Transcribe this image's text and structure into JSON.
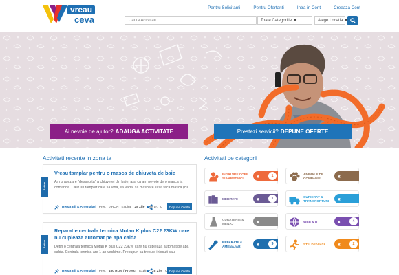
{
  "logo": {
    "brand_top": "vreau",
    "brand_bottom": "ceva"
  },
  "topnav": [
    "Pentru Solicitanti",
    "Pentru Ofertanti",
    "Intra in Cont",
    "Creeaza Cont"
  ],
  "search": {
    "placeholder": "Cauta Activitati...",
    "category_select": "Toate Categoriile",
    "location_select": "Alege Locatia"
  },
  "hero": {
    "help_text": "Ai nevoie de ajutor?",
    "help_action": "ADAUGA ACTIVITATE",
    "offer_text": "Prestezi servicii?",
    "offer_action": "DEPUNE OFERTE"
  },
  "activities": {
    "title": "Activitati recente in zona ta",
    "items": [
      {
        "status": "Activa",
        "title": "Vreau tamplar pentru o masca de chiuveta de baie",
        "description": "Am o asezare \"dessebita\" a chiuvetei din baie, asa ca am nevoie de o masca la comanda. Caut un tamplar care sa vina, sa vada, sa masoare si sa faca masca (cu",
        "category": "Reparatii & Amenajari",
        "price_label": "Pret:",
        "price": "0 RON",
        "expires_label": "Expira:",
        "expires": "28 Zile",
        "offers_label": "Oferte:",
        "offers": "0",
        "button": "Depune Oferta"
      },
      {
        "status": "Activa",
        "title": "Reparatie centrala termica Motan K plus C22 23KW care nu cupleaza automat pe apa calda",
        "description": "Detin o centrala termica Motan K plus C22 23KW care nu cupleaza automat pe apa calda. Centrala termica are 1 an vechime. Presupun ca trebuie inlocuit sau",
        "category": "Reparatii & Amenajari",
        "price_label": "Pret:",
        "price": "150 RON / Proiect",
        "expires_label": "Expira:",
        "expires": "28 Zile",
        "offers_label": "Oferte:",
        "offers": "0",
        "button": "Depune Oferta"
      }
    ]
  },
  "categories": {
    "title": "Activitati pe categorii",
    "items": [
      {
        "label": "INGRIJIRE COPII SI VARSTNICI",
        "count": "1",
        "color": "#ee6a3c",
        "icon": "family-icon"
      },
      {
        "label": "ANIMALE DE COMPANIE",
        "count": "",
        "color": "#8c6b4d",
        "icon": "paw-icon"
      },
      {
        "label": "MEDITATII",
        "count": "1",
        "color": "#6b5b95",
        "icon": "books-icon"
      },
      {
        "label": "CURIERAT & TRANSPORTURI",
        "count": "",
        "color": "#2a9fd8",
        "icon": "truck-icon"
      },
      {
        "label": "CURATENIE & MENAJ",
        "count": "",
        "color": "#8a8a8a",
        "icon": "cleaning-icon"
      },
      {
        "label": "WEB & IT",
        "count": "4",
        "color": "#7a4fb0",
        "icon": "web-icon"
      },
      {
        "label": "REPARATII & AMENAJARI",
        "count": "9",
        "color": "#1f6fae",
        "icon": "tools-icon"
      },
      {
        "label": "STIL DE VIATA",
        "count": "2",
        "color": "#f08a1c",
        "icon": "running-icon"
      }
    ]
  }
}
